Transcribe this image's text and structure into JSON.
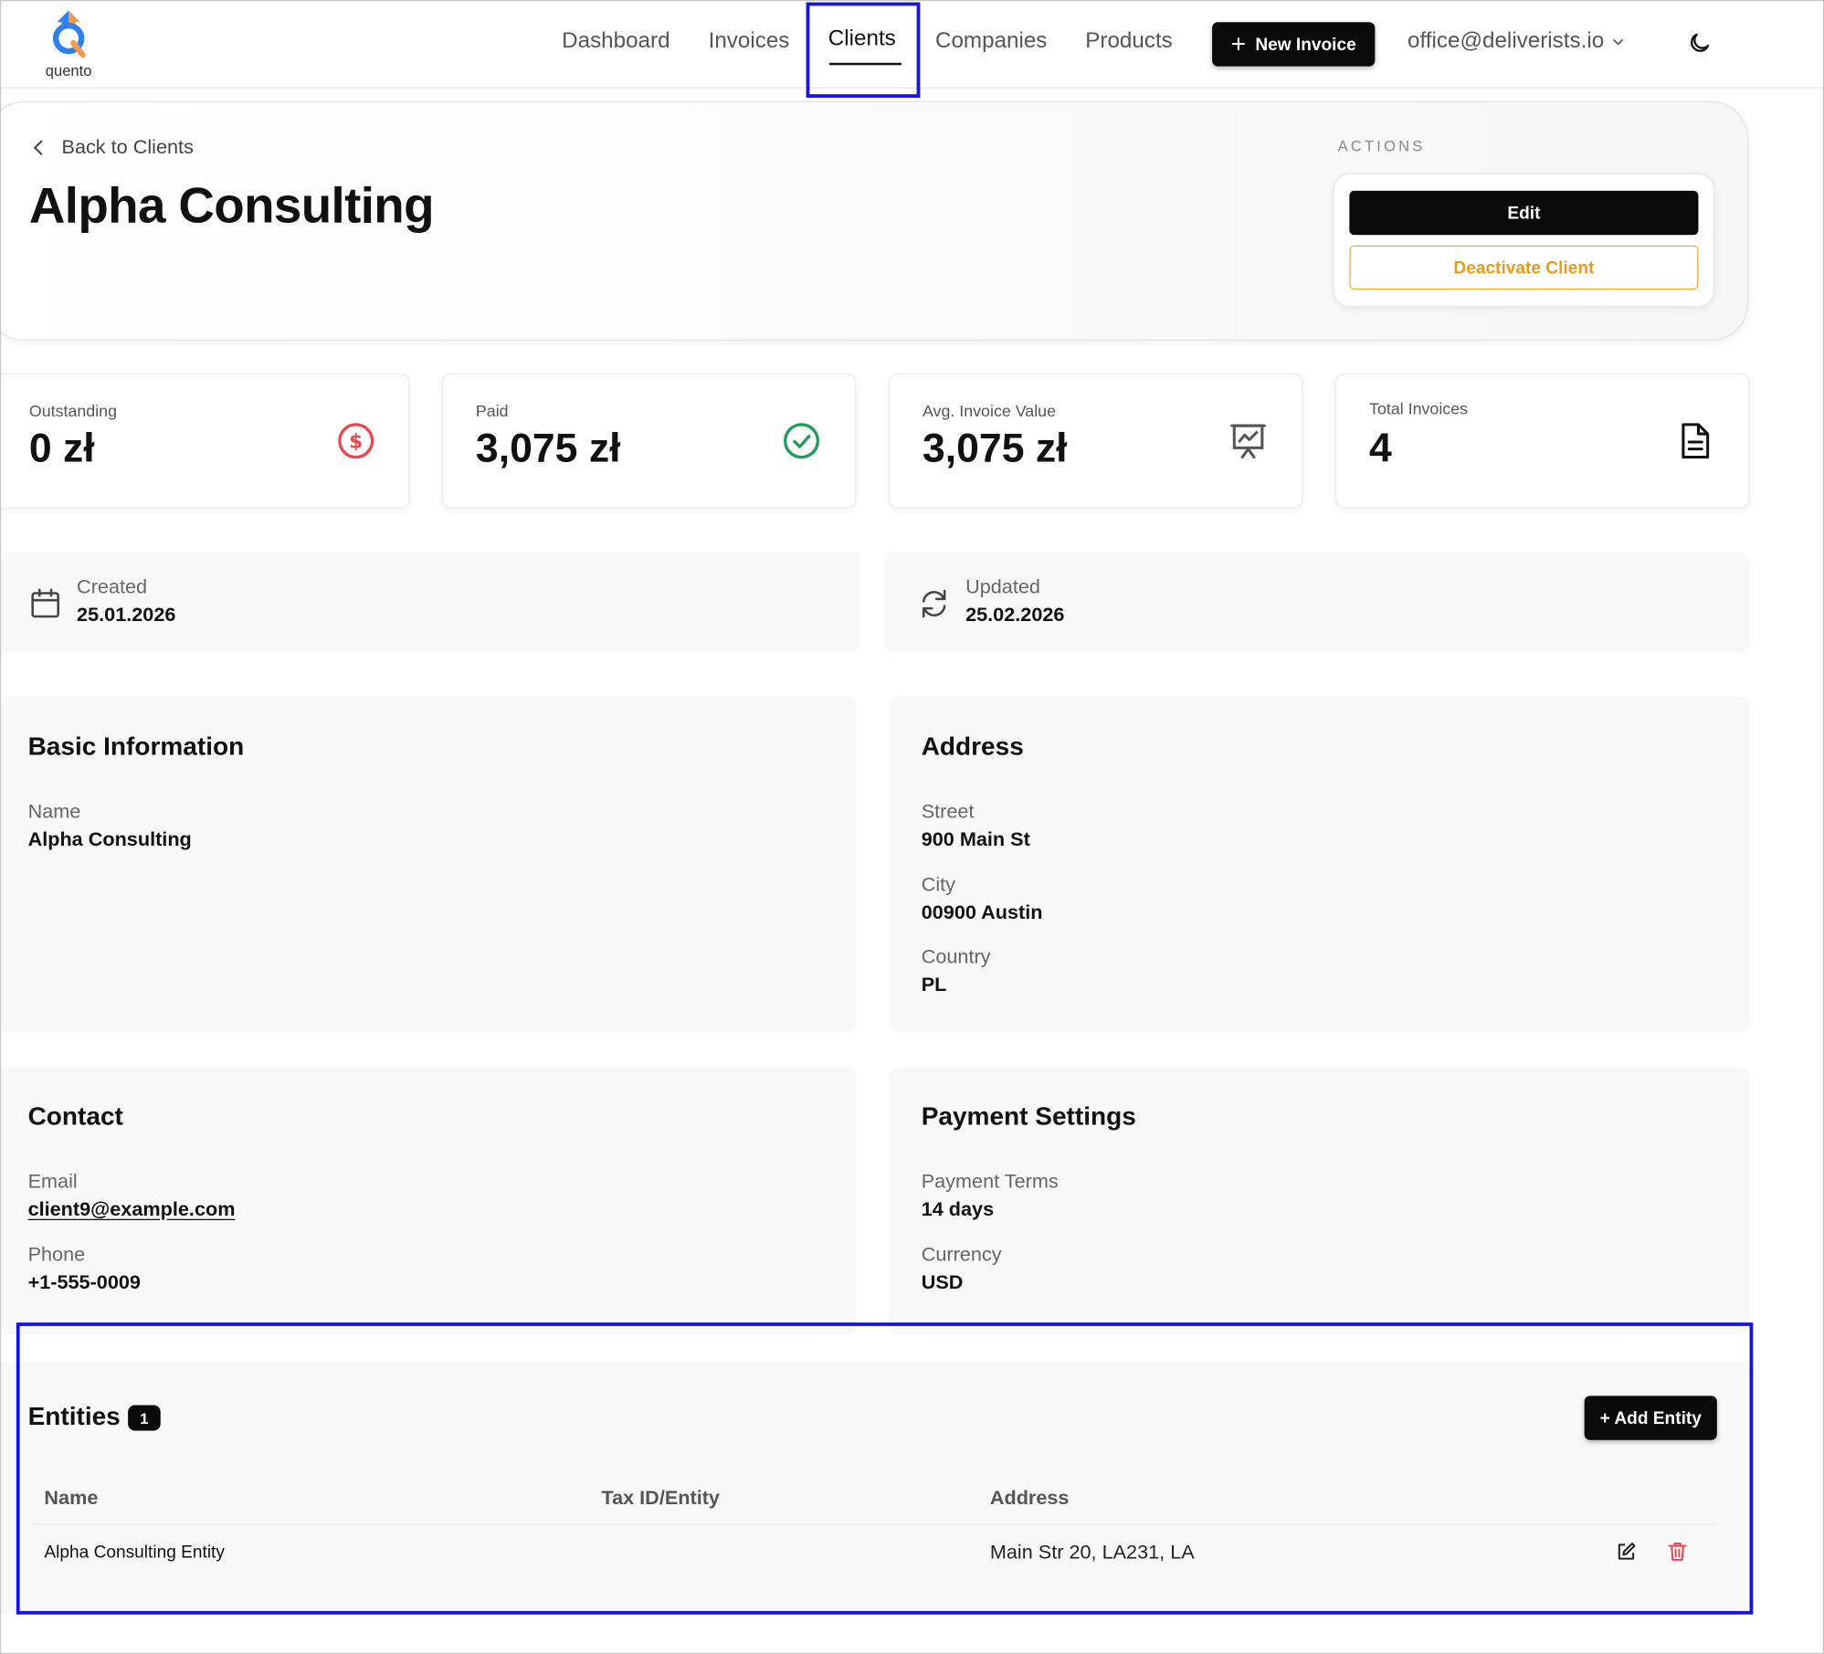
{
  "brand": {
    "logo_text": "quento"
  },
  "nav": {
    "items": [
      {
        "label": "Dashboard"
      },
      {
        "label": "Invoices"
      },
      {
        "label": "Clients",
        "active": true
      },
      {
        "label": "Companies"
      },
      {
        "label": "Products"
      }
    ],
    "new_invoice_label": "New Invoice",
    "user_email": "office@deliverists.io"
  },
  "page": {
    "back_label": "Back to Clients",
    "title": "Alpha Consulting",
    "actions_label": "ACTIONS",
    "edit_label": "Edit",
    "deactivate_label": "Deactivate Client"
  },
  "stats": [
    {
      "label": "Outstanding",
      "value": "0 zł",
      "icon": "dollar-circle-icon",
      "color": "#e5484d"
    },
    {
      "label": "Paid",
      "value": "3,075 zł",
      "icon": "check-circle-icon",
      "color": "#1f9d55"
    },
    {
      "label": "Avg. Invoice Value",
      "value": "3,075 zł",
      "icon": "presentation-chart-icon",
      "color": "#555555"
    },
    {
      "label": "Total Invoices",
      "value": "4",
      "icon": "document-icon",
      "color": "#111111"
    }
  ],
  "meta": {
    "created_label": "Created",
    "created_value": "25.01.2026",
    "updated_label": "Updated",
    "updated_value": "25.02.2026"
  },
  "basic_info": {
    "title": "Basic Information",
    "name_label": "Name",
    "name_value": "Alpha Consulting"
  },
  "address": {
    "title": "Address",
    "street_label": "Street",
    "street_value": "900 Main St",
    "city_label": "City",
    "city_value": "00900 Austin",
    "country_label": "Country",
    "country_value": "PL"
  },
  "contact": {
    "title": "Contact",
    "email_label": "Email",
    "email_value": "client9@example.com",
    "phone_label": "Phone",
    "phone_value": "+1-555-0009"
  },
  "payment": {
    "title": "Payment Settings",
    "terms_label": "Payment Terms",
    "terms_value": "14 days",
    "currency_label": "Currency",
    "currency_value": "USD"
  },
  "entities": {
    "title": "Entities",
    "count": "1",
    "add_label": "+ Add Entity",
    "columns": [
      "Name",
      "Tax ID/Entity",
      "Address"
    ],
    "rows": [
      {
        "name": "Alpha Consulting Entity",
        "tax_id": "",
        "address": "Main Str 20, LA231, LA"
      }
    ]
  },
  "colors": {
    "accent": "#0a0a0a",
    "warning": "#e89a1a",
    "highlight": "#1616e0"
  }
}
